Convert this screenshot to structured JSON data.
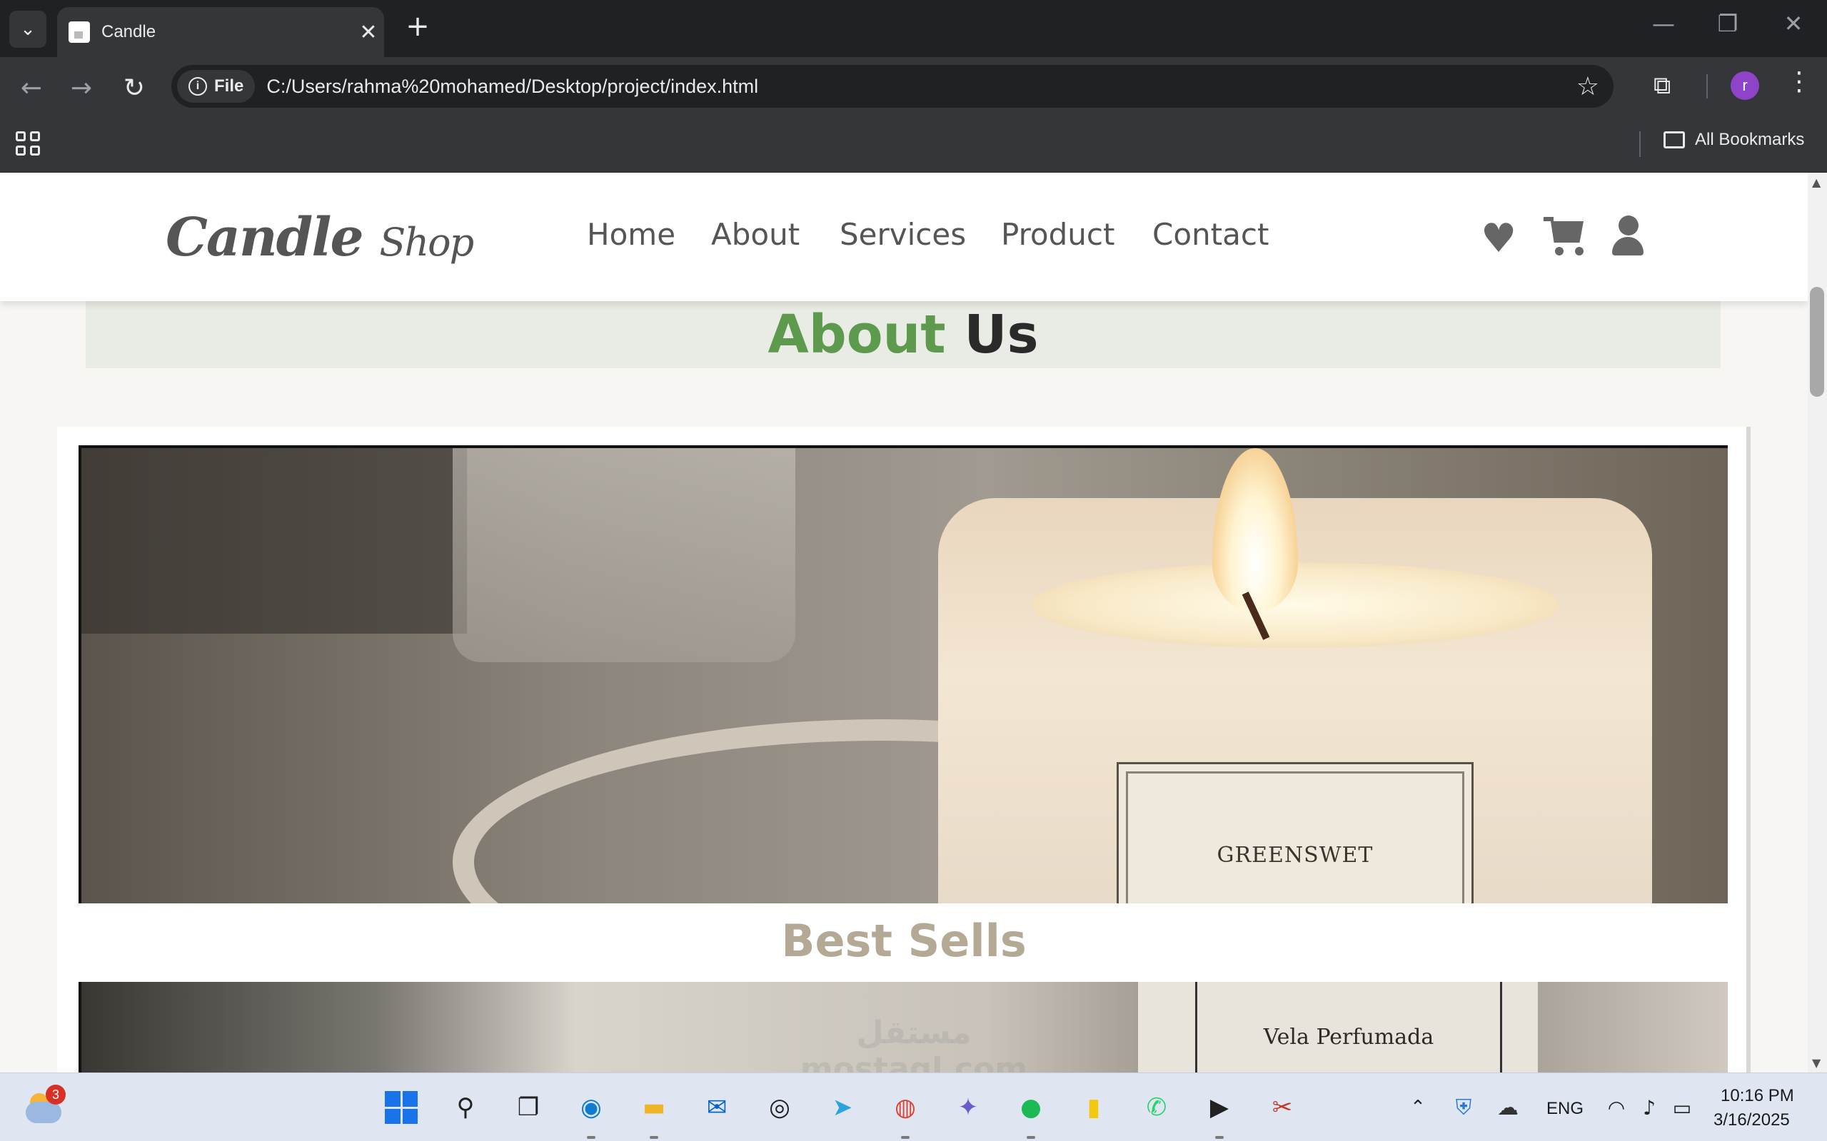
{
  "browser": {
    "tab_title": "Candle",
    "tab_close": "✕",
    "new_tab": "+",
    "site_chip": "File",
    "url": "C:/Users/rahma%20mohamed/Desktop/project/index.html",
    "profile_initial": "r",
    "all_bookmarks": "All Bookmarks",
    "window_controls": {
      "minimize": "—",
      "restore": "❐",
      "close": "✕"
    }
  },
  "site": {
    "logo_main": "Candle",
    "logo_sub": "Shop",
    "nav": [
      "Home",
      "About",
      "Services",
      "Product",
      "Contact"
    ],
    "about_title_green": "About",
    "about_title_dark": "Us",
    "photo1_label": "GREENSWET",
    "best_sells": "Best Sells",
    "photo2_label": "Vela Perfumada",
    "watermark": "مستقل mostaql.com"
  },
  "icons": {
    "wishlist": "heart-icon",
    "cart": "cart-icon",
    "account": "user-icon"
  },
  "colors": {
    "about_green": "#5e9a4e",
    "about_dark": "#2a2a2a",
    "best_sells": "#b3a994",
    "nav_text": "#555555"
  },
  "taskbar": {
    "weather_badge": "3",
    "language": "ENG",
    "time": "10:16 PM",
    "date": "3/16/2025"
  }
}
